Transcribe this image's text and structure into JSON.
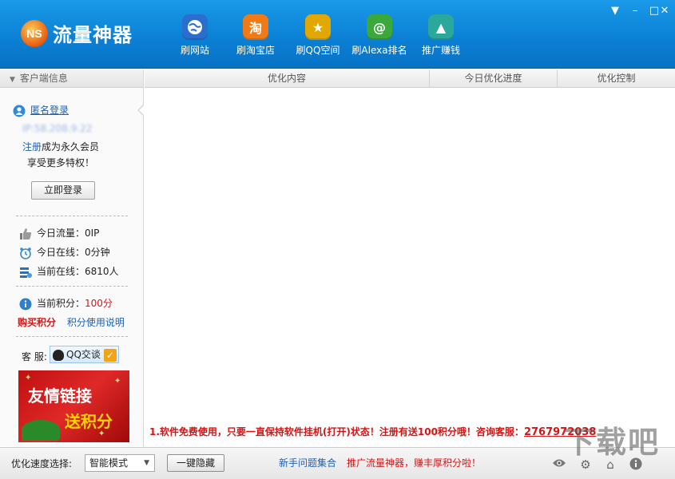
{
  "app": {
    "logo_mark": "NS",
    "title": "流量神器"
  },
  "nav": [
    {
      "label": "刷网站",
      "icon": "globe-icon",
      "color": "#2a6fd0"
    },
    {
      "label": "刷淘宝店",
      "icon": "taobao-icon",
      "glyph": "淘",
      "color": "#f07a16"
    },
    {
      "label": "刷QQ空间",
      "icon": "star-icon",
      "glyph": "★",
      "color": "#e0a800"
    },
    {
      "label": "刷Alexa排名",
      "icon": "alexa-icon",
      "glyph": "@",
      "color": "#3aa83a"
    },
    {
      "label": "推广赚钱",
      "icon": "rocket-icon",
      "glyph": "▲",
      "color": "#2aa89c"
    }
  ],
  "window_controls": {
    "menu": "▼",
    "minimize": "–",
    "maximize": "□",
    "close": "✕"
  },
  "sidebar": {
    "header": "客户端信息",
    "user_link": "匿名登录",
    "ip_masked": "IP:58.208.9.22",
    "register_link": "注册",
    "register_text": "成为永久会员",
    "privilege_text": "享受更多特权！",
    "login_button": "立即登录",
    "today_traffic": "今日流量：0IP",
    "today_online": "今日在线：0分钟",
    "current_online": "当前在线：6810人",
    "points_label": "当前积分：",
    "points_value": "100分",
    "buy_points": "购买积分",
    "points_help": "积分使用说明",
    "service_label": "客 服:",
    "qq_chat": "QQ交谈",
    "promo_line1": "友情链接",
    "promo_line2": "送积分"
  },
  "table": {
    "columns": [
      "优化内容",
      "今日优化进度",
      "优化控制"
    ]
  },
  "notice": {
    "text": "1.软件免费使用，只要一直保持软件挂机(打开)状态！注册有送100积分哦！咨询客服：",
    "number": "2767972038"
  },
  "bottom": {
    "speed_label": "优化速度选择:",
    "speed_value": "智能模式",
    "hide_button": "一键隐藏",
    "faq_link": "新手问题集合",
    "promote_link": "推广流量神器，赚丰厚积分啦！",
    "watermark": "下载吧"
  }
}
